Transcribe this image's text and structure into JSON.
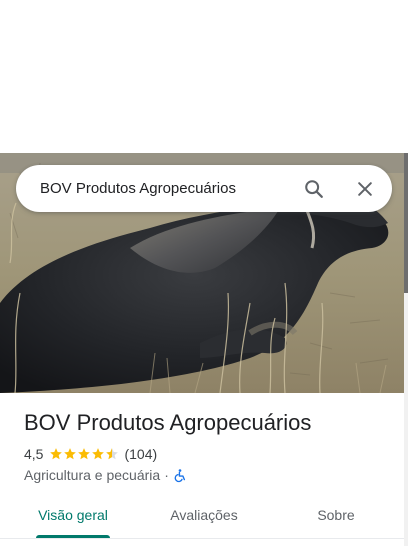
{
  "search": {
    "query": "BOV Produtos Agropecuários",
    "search_icon": "search-icon",
    "close_icon": "close-icon"
  },
  "place": {
    "name": "BOV Produtos Agropecuários",
    "rating": "4,5",
    "rating_value": 4.5,
    "reviews_count": "(104)",
    "category": "Agricultura e pecuária",
    "separator": "·",
    "accessibility_icon": "wheelchair-icon",
    "star_color": "#fbbc04",
    "accessibility_color": "#1a73e8"
  },
  "tabs": [
    {
      "label": "Visão geral",
      "active": true
    },
    {
      "label": "Avaliações",
      "active": false
    },
    {
      "label": "Sobre",
      "active": false
    }
  ],
  "colors": {
    "accent": "#00796b",
    "text_primary": "#202124",
    "text_secondary": "#5f6368"
  }
}
